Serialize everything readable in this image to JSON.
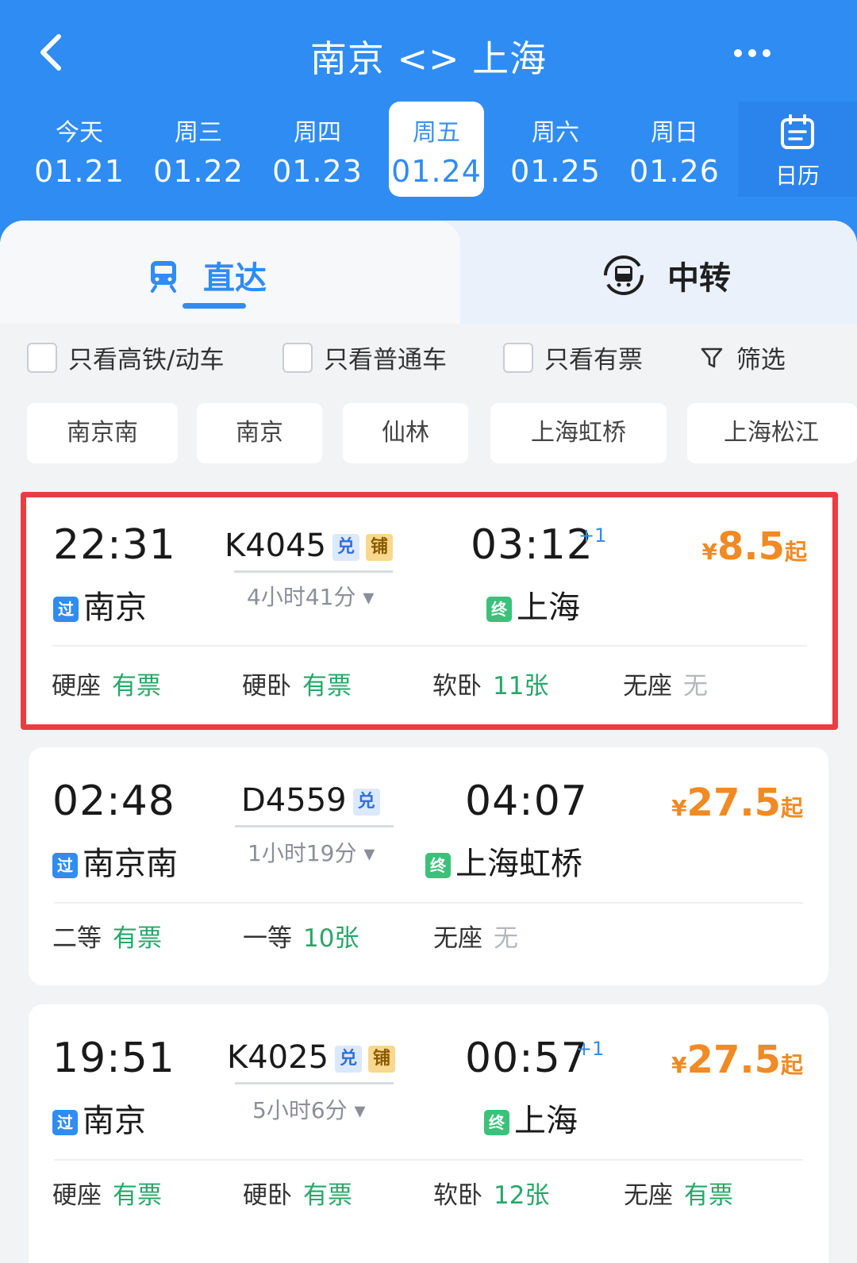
{
  "header": {
    "title": "南京 <> 上海",
    "calendar_label": "日历"
  },
  "dates": [
    {
      "weekday": "今天",
      "date": "01.21",
      "active": false
    },
    {
      "weekday": "周三",
      "date": "01.22",
      "active": false
    },
    {
      "weekday": "周四",
      "date": "01.23",
      "active": false
    },
    {
      "weekday": "周五",
      "date": "01.24",
      "active": true
    },
    {
      "weekday": "周六",
      "date": "01.25",
      "active": false
    },
    {
      "weekday": "周日",
      "date": "01.26",
      "active": false
    }
  ],
  "tabs": {
    "direct": "直达",
    "transfer": "中转"
  },
  "filters": {
    "high_speed": "只看高铁/动车",
    "regular": "只看普通车",
    "available": "只看有票",
    "filter": "筛选"
  },
  "stations": [
    "南京南",
    "南京",
    "仙林",
    "上海虹桥",
    "上海松江"
  ],
  "trains": [
    {
      "dep_time": "22:31",
      "train_no": "K4045",
      "badges": [
        "兑",
        "铺"
      ],
      "arr_time": "03:12",
      "next_day": "+1",
      "duration": "4小时41分 ▾",
      "dep_tag": "过",
      "dep_station": "南京",
      "arr_tag": "终",
      "arr_station": "上海",
      "price_symbol": "¥",
      "price": "8.5",
      "price_suffix": "起",
      "seats": [
        {
          "type": "硬座",
          "status": "有票",
          "state": "ok"
        },
        {
          "type": "硬卧",
          "status": "有票",
          "state": "ok"
        },
        {
          "type": "软卧",
          "status": "11张",
          "state": "ok"
        },
        {
          "type": "无座",
          "status": "无",
          "state": "none"
        }
      ]
    },
    {
      "dep_time": "02:48",
      "train_no": "D4559",
      "badges": [
        "兑"
      ],
      "arr_time": "04:07",
      "next_day": "",
      "duration": "1小时19分 ▾",
      "dep_tag": "过",
      "dep_station": "南京南",
      "arr_tag": "终",
      "arr_station": "上海虹桥",
      "price_symbol": "¥",
      "price": "27.5",
      "price_suffix": "起",
      "seats": [
        {
          "type": "二等",
          "status": "有票",
          "state": "ok"
        },
        {
          "type": "一等",
          "status": "10张",
          "state": "ok"
        },
        {
          "type": "无座",
          "status": "无",
          "state": "none"
        }
      ]
    },
    {
      "dep_time": "19:51",
      "train_no": "K4025",
      "badges": [
        "兑",
        "铺"
      ],
      "arr_time": "00:57",
      "next_day": "+1",
      "duration": "5小时6分 ▾",
      "dep_tag": "过",
      "dep_station": "南京",
      "arr_tag": "终",
      "arr_station": "上海",
      "price_symbol": "¥",
      "price": "27.5",
      "price_suffix": "起",
      "seats": [
        {
          "type": "硬座",
          "status": "有票",
          "state": "ok"
        },
        {
          "type": "硬卧",
          "status": "有票",
          "state": "ok"
        },
        {
          "type": "软卧",
          "status": "12张",
          "state": "ok"
        },
        {
          "type": "无座",
          "status": "有票",
          "state": "ok"
        }
      ]
    }
  ],
  "colors": {
    "brand_blue": "#2f8cf2",
    "price_orange": "#f08a24",
    "available_green": "#27a768",
    "highlight_red": "#ec3c43"
  }
}
